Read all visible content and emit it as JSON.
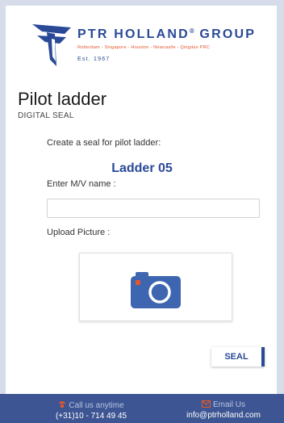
{
  "brand": {
    "name": "PTR HOLLAND",
    "name_suffix": "GROUP",
    "registered_mark": "®",
    "cities": "Rotterdam - Singapore - Houston - Newcastle - Qingdao PRC",
    "established": "Est. 1967",
    "colors": {
      "primary": "#2a4a97",
      "accent": "#e3572c"
    }
  },
  "header": {
    "title": "Pilot ladder",
    "subtitle": "DIGITAL SEAL"
  },
  "form": {
    "create_label": "Create a seal for pilot ladder:",
    "ladder_name": "Ladder 05",
    "mv_label": "Enter M/V name :",
    "mv_value": "",
    "mv_placeholder": "",
    "upload_label": "Upload Picture :",
    "upload_icon": "camera-icon",
    "submit_label": "SEAL"
  },
  "footer": {
    "phone_heading": "Call us anytime",
    "phone_icon": "phone-icon",
    "phone_value": "(+31)10 - 714 49 45",
    "email_heading": "Email Us",
    "email_icon": "mail-icon",
    "email_value": "info@ptrholland.com"
  }
}
